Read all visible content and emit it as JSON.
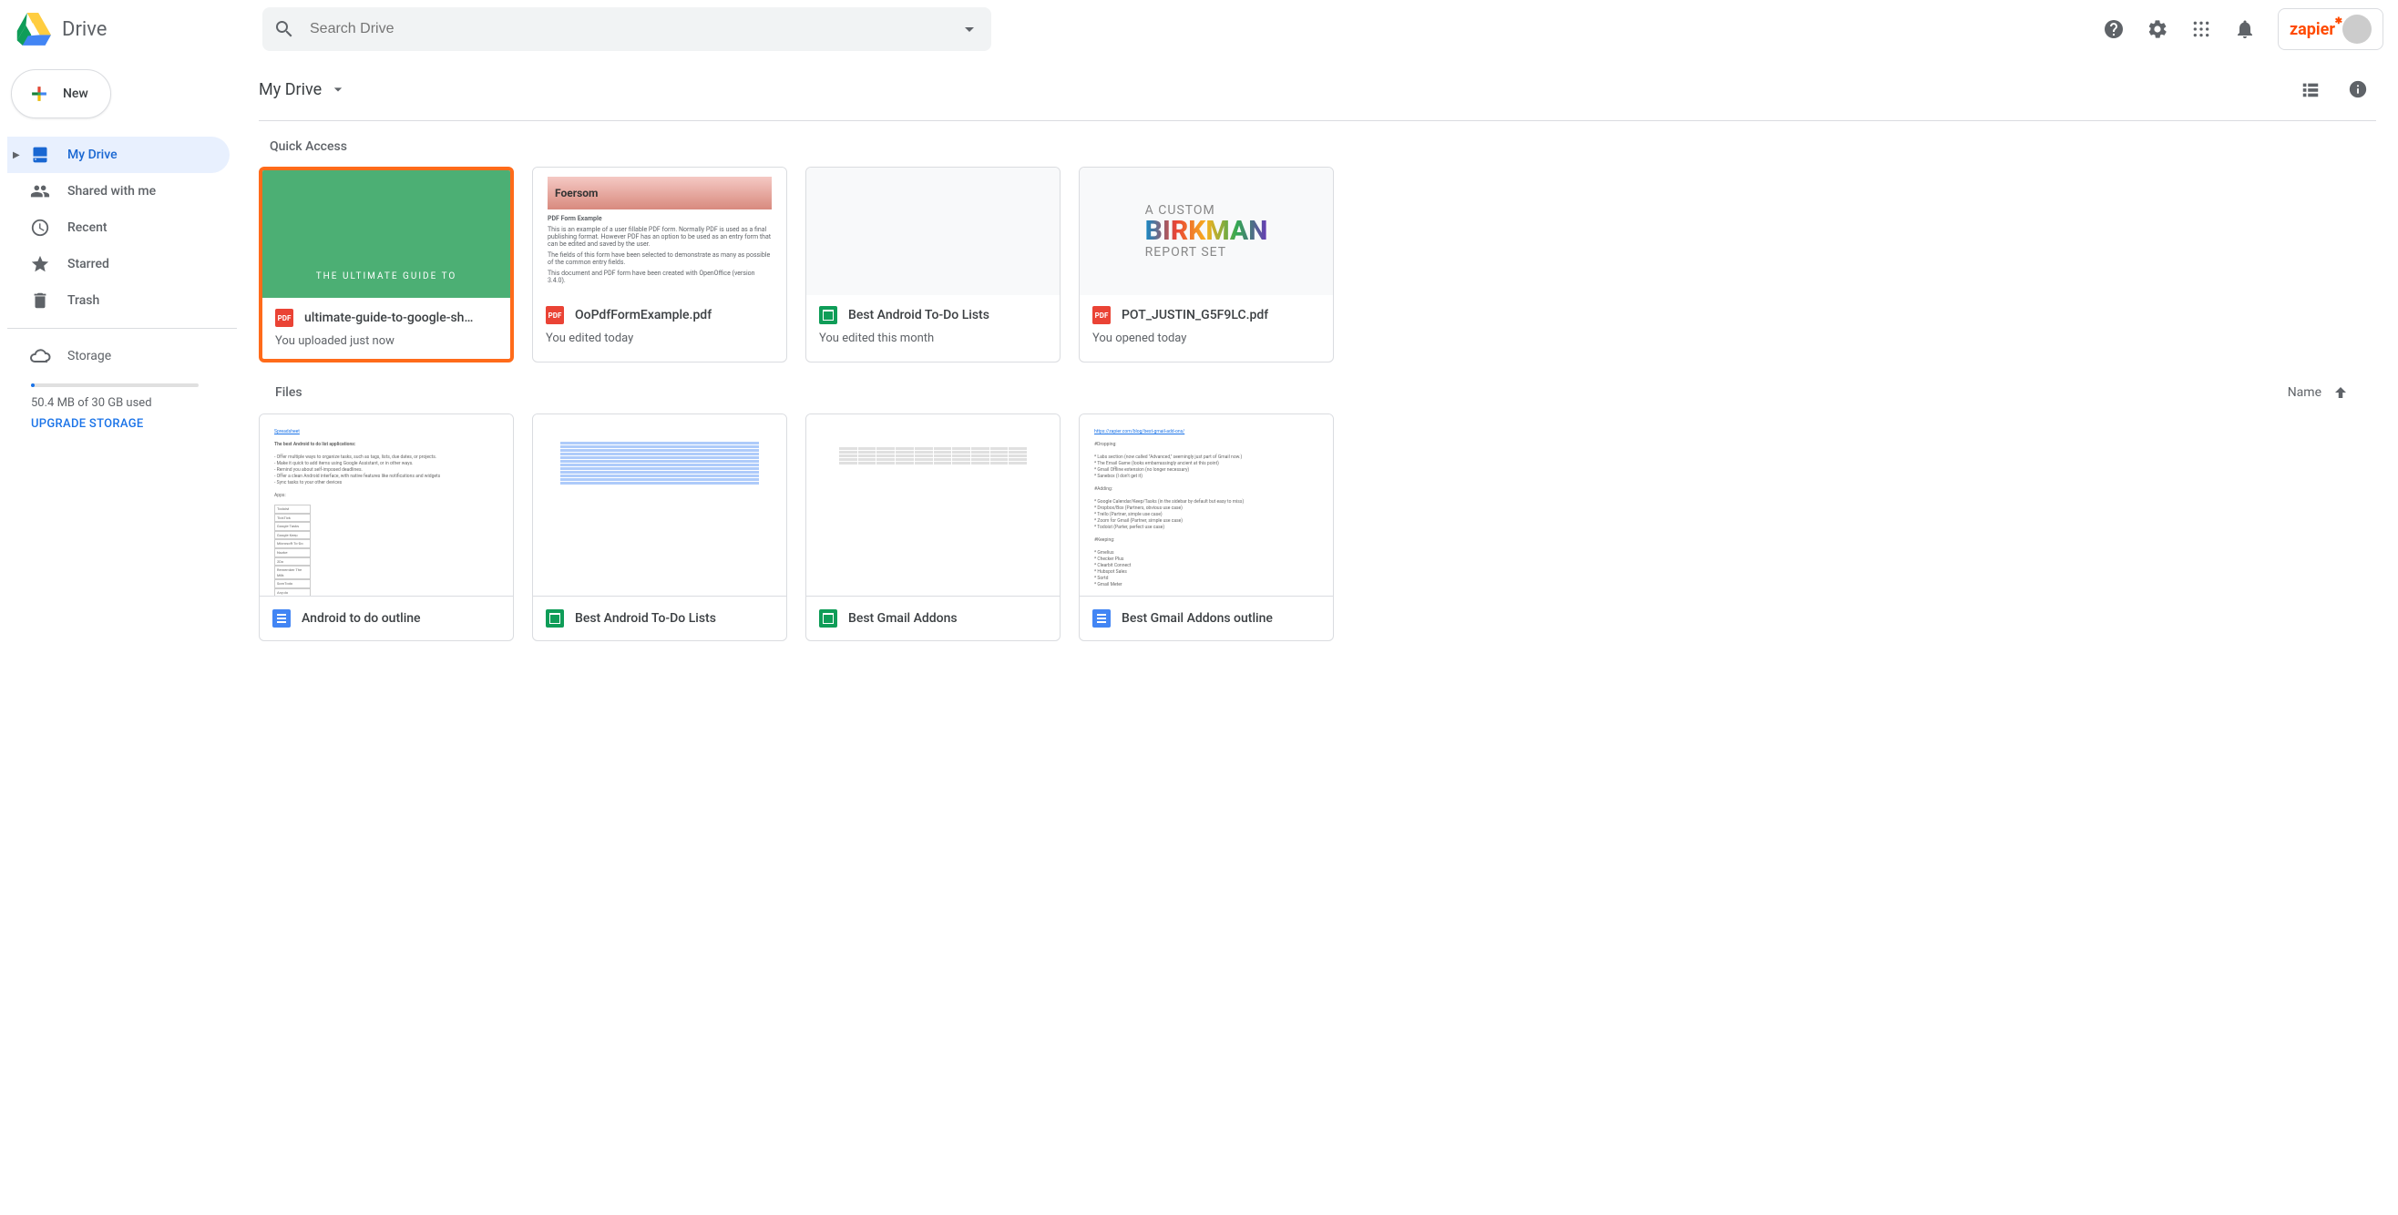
{
  "app": {
    "name": "Drive"
  },
  "search": {
    "placeholder": "Search Drive"
  },
  "header": {
    "zapier": "zapier"
  },
  "new_button": {
    "label": "New"
  },
  "nav": {
    "my_drive": "My Drive",
    "shared": "Shared with me",
    "recent": "Recent",
    "starred": "Starred",
    "trash": "Trash"
  },
  "storage": {
    "label": "Storage",
    "used": "50.4 MB of 30 GB used",
    "upgrade": "UPGRADE STORAGE"
  },
  "breadcrumb": {
    "root": "My Drive"
  },
  "sections": {
    "quick_access": "Quick Access",
    "files": "Files",
    "sort_label": "Name"
  },
  "quick_access": [
    {
      "title": "ultimate-guide-to-google-sh…",
      "subtitle": "You uploaded just now",
      "type": "pdf",
      "preview_text": "THE ULTIMATE GUIDE TO",
      "highlighted": true
    },
    {
      "title": "OoPdfFormExample.pdf",
      "subtitle": "You edited today",
      "type": "pdf",
      "preview_banner": "Foersom",
      "preview_heading": "PDF Form Example"
    },
    {
      "title": "Best Android To-Do Lists",
      "subtitle": "You edited this month",
      "type": "sheets"
    },
    {
      "title": "POT_JUSTIN_G5F9LC.pdf",
      "subtitle": "You opened today",
      "type": "pdf",
      "birkman_top": "A CUSTOM",
      "birkman_mid": "BIRKMAN",
      "birkman_bot": "REPORT SET"
    }
  ],
  "files": [
    {
      "title": "Android to do outline",
      "type": "docs"
    },
    {
      "title": "Best Android To-Do Lists",
      "type": "sheets"
    },
    {
      "title": "Best Gmail Addons",
      "type": "sheets"
    },
    {
      "title": "Best Gmail Addons outline",
      "type": "docs"
    }
  ]
}
